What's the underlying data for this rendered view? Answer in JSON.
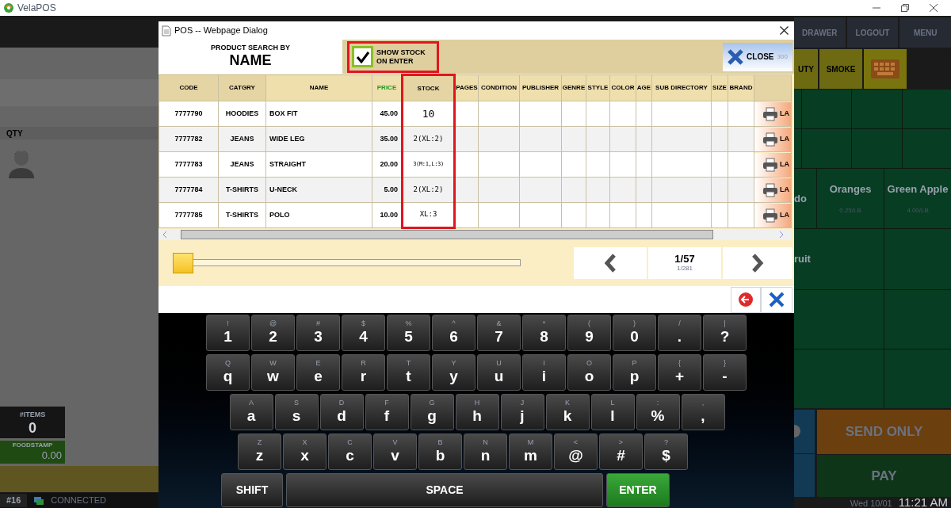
{
  "app": {
    "title": "VelaPOS"
  },
  "left_panel": {
    "qty_label": "QTY",
    "items": {
      "label": "#ITEMS",
      "value": "0"
    },
    "foodstamp": {
      "label": "FOODSTAMP",
      "value": "0.00"
    }
  },
  "status_bar": {
    "station": "#16",
    "connection": "CONNECTED",
    "date": "Wed 10/01",
    "time": "11:21 AM"
  },
  "top_buttons": [
    "DRAWER",
    "LOGOUT",
    "MENU"
  ],
  "category_buttons": [
    {
      "kind": "text",
      "label": "UTY"
    },
    {
      "kind": "text",
      "label": "SMOKE"
    },
    {
      "kind": "keyboard"
    }
  ],
  "product_tiles": [
    {
      "name": "do"
    },
    {
      "name": "Oranges",
      "price": "0.25/LB"
    },
    {
      "name": "Green Apple",
      "price": "4.00/LB"
    },
    {
      "name": "ruit"
    }
  ],
  "action_buttons": [
    {
      "kind": "send",
      "label": "SEND ONLY"
    },
    {
      "kind": "pay",
      "label": "PAY"
    }
  ],
  "dialog": {
    "title": "POS -- Webpage Dialog",
    "search_by": {
      "caption": "PRODUCT SEARCH BY",
      "value": "NAME"
    },
    "show_stock": {
      "lines": [
        "SHOW STOCK",
        "ON ENTER"
      ],
      "checked": true,
      "highlighted": true
    },
    "close_button": {
      "label": "CLOSE",
      "count": "300"
    },
    "table": {
      "columns": [
        {
          "label": "CODE",
          "kind": "code"
        },
        {
          "label": "CATGRY",
          "kind": "code"
        },
        {
          "label": "NAME",
          "kind": "name"
        },
        {
          "label": "PRICE",
          "kind": "price"
        },
        {
          "label": "STOCK",
          "kind": "stock",
          "highlighted": true
        },
        {
          "label": "PAGES",
          "kind": "plain"
        },
        {
          "label": "CONDITION",
          "kind": "plain"
        },
        {
          "label": "PUBLISHER",
          "kind": "plain"
        },
        {
          "label": "GENRE",
          "kind": "plain"
        },
        {
          "label": "STYLE",
          "kind": "plain"
        },
        {
          "label": "COLOR",
          "kind": "plain"
        },
        {
          "label": "AGE",
          "kind": "plain"
        },
        {
          "label": "SUB DIRECTORY",
          "kind": "plain"
        },
        {
          "label": "SIZE",
          "kind": "plain"
        },
        {
          "label": "BRAND",
          "kind": "plain"
        }
      ],
      "rows": [
        {
          "cells": [
            "7777790",
            "HOODIES",
            "BOX FIT",
            "45.00",
            "10"
          ],
          "label_button": "LA"
        },
        {
          "cells": [
            "7777782",
            "JEANS",
            "WIDE LEG",
            "35.00",
            "2(XL:2)"
          ],
          "label_button": "LA"
        },
        {
          "cells": [
            "7777783",
            "JEANS",
            "STRAIGHT",
            "20.00",
            "3(M:1,L:3)"
          ],
          "label_button": "LA"
        },
        {
          "cells": [
            "7777784",
            "T-SHIRTS",
            "U-NECK",
            "5.00",
            "2(XL:2)"
          ],
          "label_button": "LA"
        },
        {
          "cells": [
            "7777785",
            "T-SHIRTS",
            "POLO",
            "10.00",
            "XL:3"
          ],
          "label_button": "LA"
        }
      ]
    },
    "slider": {
      "level": 0
    },
    "pager": {
      "page": "1/57",
      "total": "1/281"
    },
    "keyboard": {
      "rows": [
        [
          {
            "top": "!",
            "main": "1"
          },
          {
            "top": "@",
            "main": "2"
          },
          {
            "top": "#",
            "main": "3"
          },
          {
            "top": "$",
            "main": "4"
          },
          {
            "top": "%",
            "main": "5"
          },
          {
            "top": "^",
            "main": "6"
          },
          {
            "top": "&",
            "main": "7"
          },
          {
            "top": "*",
            "main": "8"
          },
          {
            "top": "(",
            "main": "9"
          },
          {
            "top": ")",
            "main": "0"
          },
          {
            "top": "/",
            "main": "."
          },
          {
            "top": "|",
            "main": "?"
          }
        ],
        [
          {
            "top": "Q",
            "main": "q"
          },
          {
            "top": "W",
            "main": "w"
          },
          {
            "top": "E",
            "main": "e"
          },
          {
            "top": "R",
            "main": "r"
          },
          {
            "top": "T",
            "main": "t"
          },
          {
            "top": "Y",
            "main": "y"
          },
          {
            "top": "U",
            "main": "u"
          },
          {
            "top": "I",
            "main": "i"
          },
          {
            "top": "O",
            "main": "o"
          },
          {
            "top": "P",
            "main": "p"
          },
          {
            "top": "{",
            "main": "+"
          },
          {
            "top": "}",
            "main": "-"
          }
        ],
        [
          {
            "top": "A",
            "main": "a"
          },
          {
            "top": "S",
            "main": "s"
          },
          {
            "top": "D",
            "main": "d"
          },
          {
            "top": "F",
            "main": "f"
          },
          {
            "top": "G",
            "main": "g"
          },
          {
            "top": "H",
            "main": "h"
          },
          {
            "top": "J",
            "main": "j"
          },
          {
            "top": "K",
            "main": "k"
          },
          {
            "top": "L",
            "main": "l"
          },
          {
            "top": ":",
            "main": "%"
          },
          {
            "top": ",",
            "main": ","
          }
        ],
        [
          {
            "top": "Z",
            "main": "z"
          },
          {
            "top": "X",
            "main": "x"
          },
          {
            "top": "C",
            "main": "c"
          },
          {
            "top": "V",
            "main": "v"
          },
          {
            "top": "B",
            "main": "b"
          },
          {
            "top": "N",
            "main": "n"
          },
          {
            "top": "M",
            "main": "m"
          },
          {
            "top": "<",
            "main": "@"
          },
          {
            "top": ">",
            "main": "#"
          },
          {
            "top": "?",
            "main": "$"
          }
        ]
      ],
      "bottom": [
        {
          "kind": "shift",
          "label": "SHIFT"
        },
        {
          "kind": "space",
          "label": "SPACE"
        },
        {
          "kind": "enter",
          "label": "ENTER"
        }
      ]
    }
  }
}
